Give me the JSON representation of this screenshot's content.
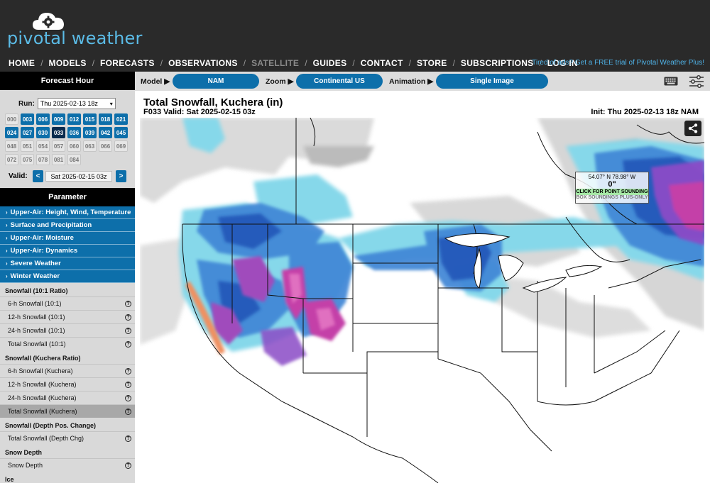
{
  "header": {
    "brand": "pivotal weather",
    "nav": [
      {
        "label": "HOME",
        "dim": false
      },
      {
        "label": "MODELS",
        "dim": false
      },
      {
        "label": "FORECASTS",
        "dim": false
      },
      {
        "label": "OBSERVATIONS",
        "dim": false
      },
      {
        "label": "SATELLITE",
        "dim": true
      },
      {
        "label": "GUIDES",
        "dim": false
      },
      {
        "label": "CONTACT",
        "dim": false
      },
      {
        "label": "STORE",
        "dim": false
      },
      {
        "label": "SUBSCRIPTIONS",
        "dim": false
      },
      {
        "label": "LOG IN",
        "dim": false
      }
    ],
    "nav_separator": "/",
    "promo": "Tired of ads? Get a FREE trial of Pivotal Weather Plus!"
  },
  "sidebar": {
    "forecast_hour_title": "Forecast Hour",
    "run_label": "Run:",
    "run_value": "Thu 2025-02-13 18z",
    "hours": [
      {
        "h": "000",
        "state": "na"
      },
      {
        "h": "003",
        "state": "avail"
      },
      {
        "h": "006",
        "state": "avail"
      },
      {
        "h": "009",
        "state": "avail"
      },
      {
        "h": "012",
        "state": "avail"
      },
      {
        "h": "015",
        "state": "avail"
      },
      {
        "h": "018",
        "state": "avail"
      },
      {
        "h": "021",
        "state": "avail"
      },
      {
        "h": "024",
        "state": "avail"
      },
      {
        "h": "027",
        "state": "avail"
      },
      {
        "h": "030",
        "state": "avail"
      },
      {
        "h": "033",
        "state": "sel"
      },
      {
        "h": "036",
        "state": "avail"
      },
      {
        "h": "039",
        "state": "avail"
      },
      {
        "h": "042",
        "state": "avail"
      },
      {
        "h": "045",
        "state": "avail"
      },
      {
        "h": "048",
        "state": "na"
      },
      {
        "h": "051",
        "state": "na"
      },
      {
        "h": "054",
        "state": "na"
      },
      {
        "h": "057",
        "state": "na"
      },
      {
        "h": "060",
        "state": "na"
      },
      {
        "h": "063",
        "state": "na"
      },
      {
        "h": "066",
        "state": "na"
      },
      {
        "h": "069",
        "state": "na"
      },
      {
        "h": "072",
        "state": "na"
      },
      {
        "h": "075",
        "state": "na"
      },
      {
        "h": "078",
        "state": "na"
      },
      {
        "h": "081",
        "state": "na"
      },
      {
        "h": "084",
        "state": "na"
      }
    ],
    "valid_label": "Valid:",
    "valid_value": "Sat 2025-02-15 03z",
    "prev": "<",
    "next": ">",
    "parameter_title": "Parameter",
    "categories": [
      "Upper-Air: Height, Wind, Temperature",
      "Surface and Precipitation",
      "Upper-Air: Moisture",
      "Upper-Air: Dynamics",
      "Severe Weather",
      "Winter Weather"
    ],
    "groups": [
      {
        "title": "Snowfall (10:1 Ratio)",
        "items": [
          "6-h Snowfall (10:1)",
          "12-h Snowfall (10:1)",
          "24-h Snowfall (10:1)",
          "Total Snowfall (10:1)"
        ]
      },
      {
        "title": "Snowfall (Kuchera Ratio)",
        "items": [
          "6-h Snowfall (Kuchera)",
          "12-h Snowfall (Kuchera)",
          "24-h Snowfall (Kuchera)",
          "Total Snowfall (Kuchera)"
        ]
      },
      {
        "title": "Snowfall (Depth Pos. Change)",
        "items": [
          "Total Snowfall (Depth Chg)"
        ]
      },
      {
        "title": "Snow Depth",
        "items": [
          "Snow Depth"
        ]
      },
      {
        "title": "Ice",
        "items": []
      }
    ],
    "active_item": "Total Snowfall (Kuchera)",
    "help_glyph": "?"
  },
  "toolbar": {
    "model_label": "Model ▶",
    "model_value": "NAM",
    "zoom_label": "Zoom ▶",
    "zoom_value": "Continental US",
    "animation_label": "Animation ▶",
    "animation_value": "Single Image"
  },
  "map": {
    "title": "Total Snowfall, Kuchera (in)",
    "subtitle": "F033 Valid: Sat 2025-02-15 03z",
    "init": "Init: Thu 2025-02-13 18z NAM",
    "sounding": {
      "coord": "54.07° N 78.98° W",
      "value": "0\"",
      "click": "CLICK FOR POINT SOUNDING",
      "box": "BOX SOUNDINGS PLUS-ONLY"
    },
    "colors": {
      "light_gray": "#d8d8d8",
      "mid_gray": "#a8a8a8",
      "cyan": "#7fd3e8",
      "blue": "#3f86d6",
      "dark_blue": "#2456b8",
      "purple": "#8a4bc6",
      "magenta": "#c43fa8",
      "pink": "#e070c0",
      "orange": "#f09060"
    }
  }
}
